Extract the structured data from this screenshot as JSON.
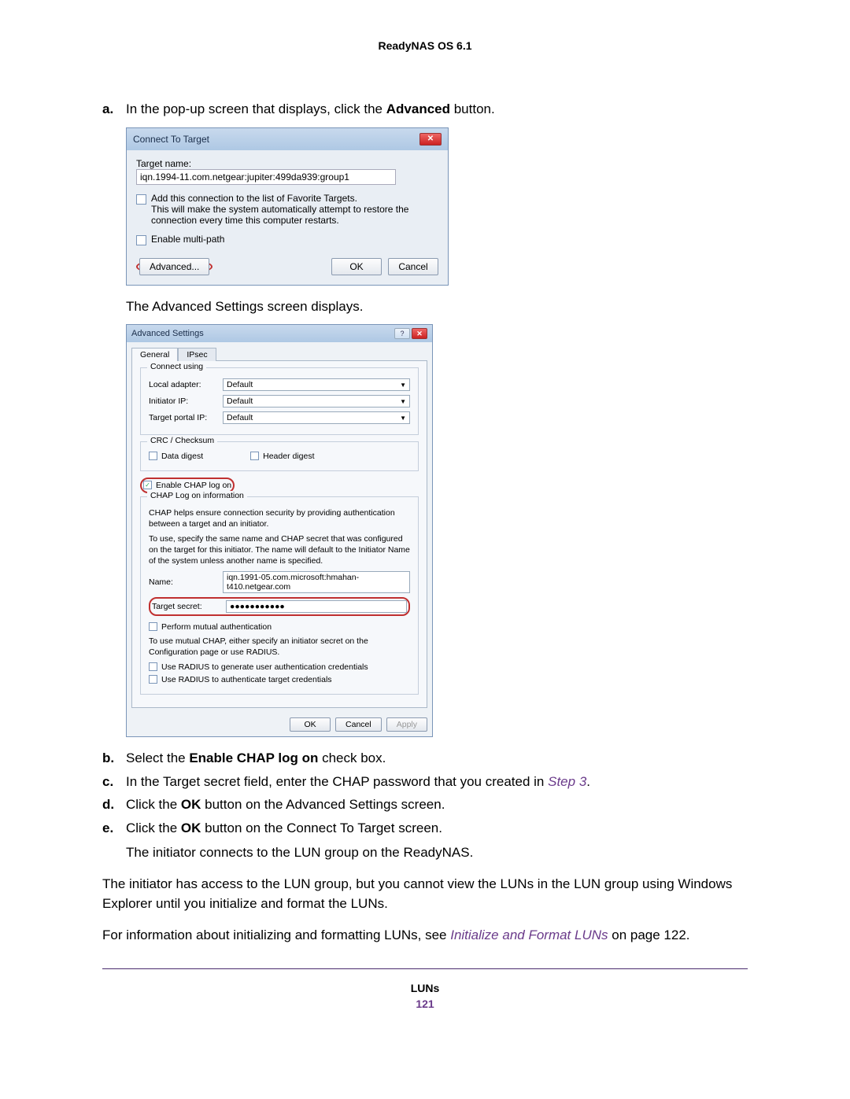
{
  "header": "ReadyNAS OS 6.1",
  "steps": {
    "a": {
      "marker": "a.",
      "pre": "In the pop-up screen that displays, click the ",
      "bold": "Advanced",
      "post": " button."
    },
    "a_after": "The Advanced Settings screen displays.",
    "b": {
      "marker": "b.",
      "pre": "Select the ",
      "bold": "Enable CHAP log on",
      "post": " check box."
    },
    "c": {
      "marker": "c.",
      "pre": "In the Target secret field, enter the CHAP password that you created in ",
      "link": "Step 3",
      "post": "."
    },
    "d": {
      "marker": "d.",
      "pre": "Click the ",
      "bold": "OK",
      "post": " button on the Advanced Settings screen."
    },
    "e": {
      "marker": "e.",
      "pre": "Click the ",
      "bold": "OK",
      "post": " button on the Connect To Target screen."
    },
    "e_after": "The initiator connects to the LUN group on the ReadyNAS."
  },
  "para1": "The initiator has access to the LUN group, but you cannot view the LUNs in the LUN group using Windows Explorer until you initialize and format the LUNs.",
  "para2_pre": "For information about initializing and formatting LUNs, see ",
  "para2_link": "Initialize and Format LUNs",
  "para2_post": " on page 122.",
  "footer": {
    "section": "LUNs",
    "page": "121"
  },
  "dlg1": {
    "title": "Connect To Target",
    "target_name_label": "Target name:",
    "target_name_value": "iqn.1994-11.com.netgear:jupiter:499da939:group1",
    "fav_label": "Add this connection to the list of Favorite Targets.",
    "fav_desc": "This will make the system automatically attempt to restore the connection every time this computer restarts.",
    "multi_label": "Enable multi-path",
    "btn_advanced": "Advanced...",
    "btn_ok": "OK",
    "btn_cancel": "Cancel"
  },
  "dlg2": {
    "title": "Advanced Settings",
    "tab_general": "General",
    "tab_ipsec": "IPsec",
    "grp_connect": "Connect using",
    "local_adapter_label": "Local adapter:",
    "local_adapter_value": "Default",
    "initiator_ip_label": "Initiator IP:",
    "initiator_ip_value": "Default",
    "target_portal_ip_label": "Target portal IP:",
    "target_portal_ip_value": "Default",
    "grp_crc": "CRC / Checksum",
    "data_digest": "Data digest",
    "header_digest": "Header digest",
    "enable_chap": "Enable CHAP log on",
    "grp_chap": "CHAP Log on information",
    "chap_desc1": "CHAP helps ensure connection security by providing authentication between a target and an initiator.",
    "chap_desc2": "To use, specify the same name and CHAP secret that was configured on the target for this initiator.  The name will default to the Initiator Name of the system unless another name is specified.",
    "name_label": "Name:",
    "name_value": "iqn.1991-05.com.microsoft:hmahan-t410.netgear.com",
    "secret_label": "Target secret:",
    "secret_value": "●●●●●●●●●●●",
    "mutual_label": "Perform mutual authentication",
    "mutual_desc": "To use mutual CHAP, either specify an initiator secret on the Configuration page or use RADIUS.",
    "radius1": "Use RADIUS to generate user authentication credentials",
    "radius2": "Use RADIUS to authenticate target credentials",
    "btn_ok": "OK",
    "btn_cancel": "Cancel",
    "btn_apply": "Apply"
  }
}
